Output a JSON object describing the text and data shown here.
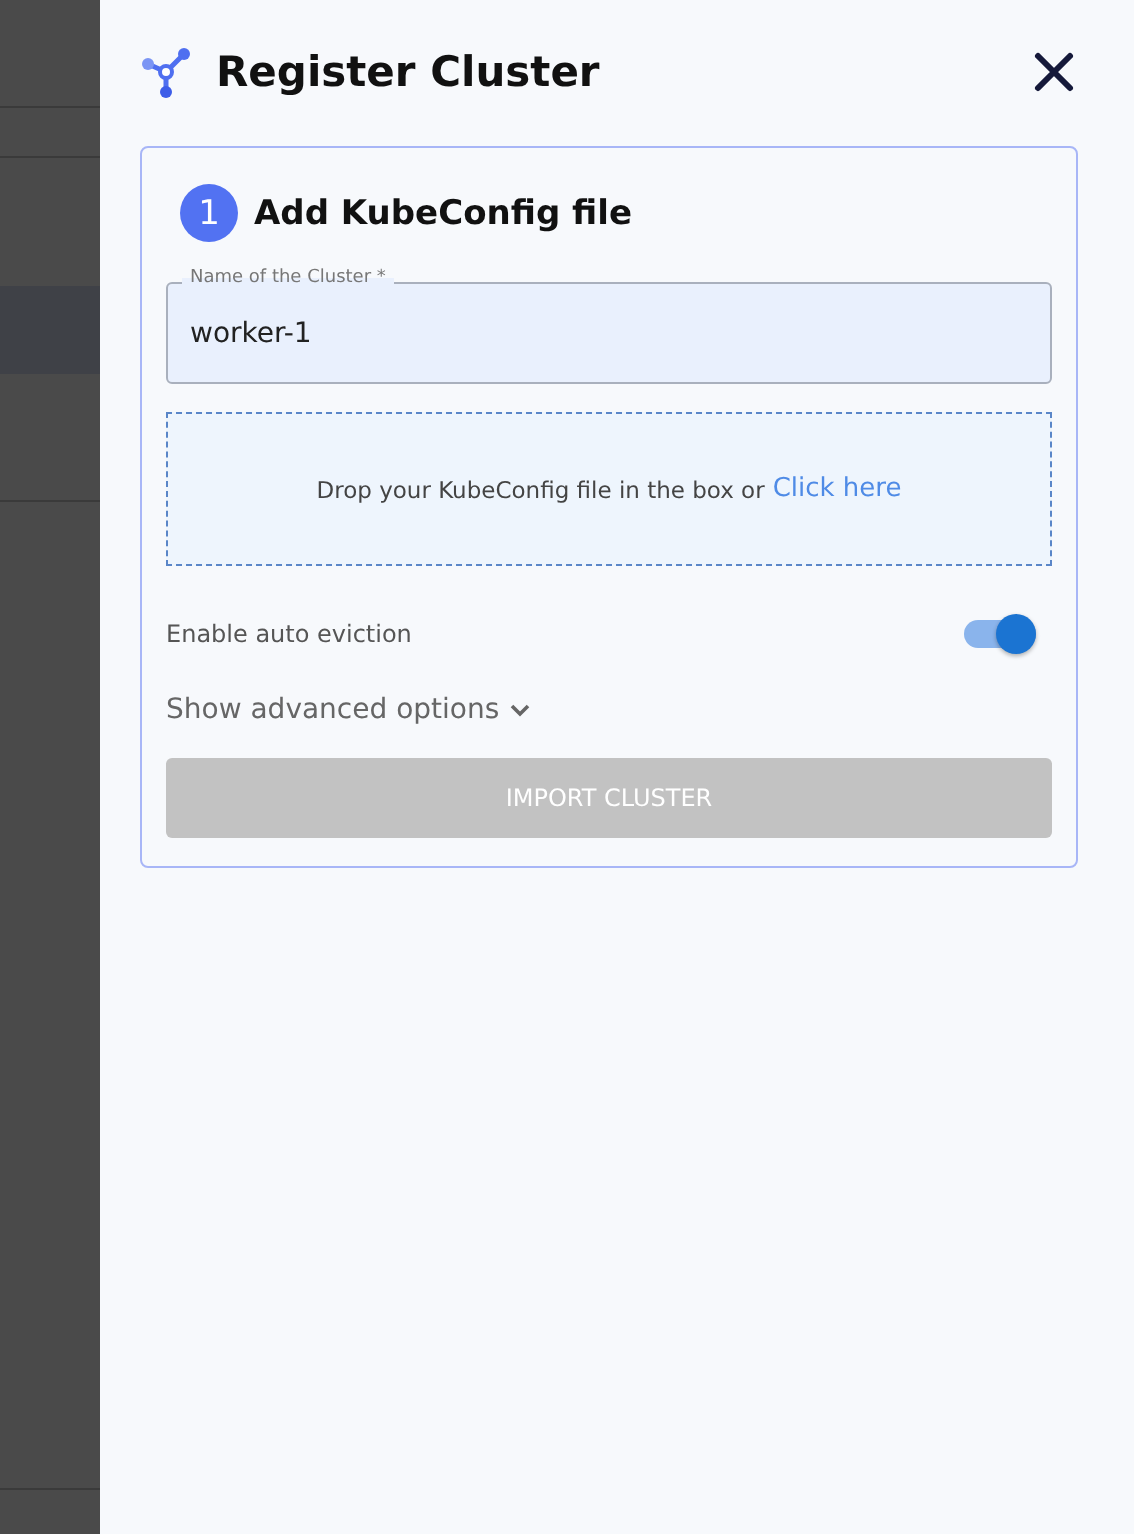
{
  "panel": {
    "title": "Register Cluster"
  },
  "step": {
    "number": "1",
    "title": "Add KubeConfig file"
  },
  "name_field": {
    "label": "Name of the Cluster *",
    "value": "worker-1"
  },
  "dropzone": {
    "text": "Drop your KubeConfig file in the box or",
    "link": "Click here"
  },
  "auto_eviction": {
    "label": "Enable auto eviction",
    "on": true
  },
  "advanced": {
    "label": "Show advanced options",
    "expanded": false
  },
  "import_button": {
    "label": "IMPORT CLUSTER",
    "disabled": true
  }
}
